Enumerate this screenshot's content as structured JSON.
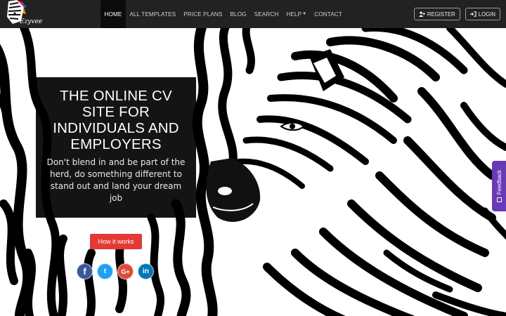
{
  "brand": {
    "logo_text": "Ezyvee"
  },
  "nav": {
    "items": [
      {
        "label": "HOME",
        "active": true
      },
      {
        "label": "ALL TEMPLATES"
      },
      {
        "label": "PRICE PLANS"
      },
      {
        "label": "BLOG"
      },
      {
        "label": "SEARCH"
      },
      {
        "label": "HELP"
      },
      {
        "label": "CONTACT"
      }
    ],
    "register_label": "REGISTER",
    "login_label": "LOGIN"
  },
  "hero": {
    "title": "THE ONLINE CV SITE FOR INDIVIDUALS AND EMPLOYERS",
    "subtitle": "Don't blend in and be part of the herd, do something different to stand out and land your dream job",
    "cta_label": "How it works"
  },
  "social": [
    {
      "name": "facebook",
      "glyph": "f",
      "color": "#3b5998"
    },
    {
      "name": "twitter",
      "glyph": "t",
      "color": "#1da1f2"
    },
    {
      "name": "google-plus",
      "glyph": "G+",
      "color": "#dd4b39"
    },
    {
      "name": "linkedin",
      "glyph": "in",
      "color": "#0077b5"
    }
  ],
  "feedback": {
    "label": "Feedback",
    "color": "#673ab7"
  },
  "colors": {
    "navbar": "#222222",
    "accent_red": "#e53935"
  }
}
